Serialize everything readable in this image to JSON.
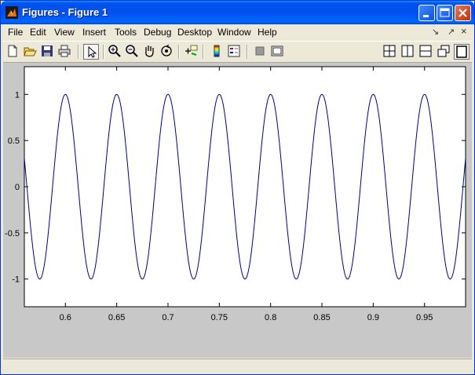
{
  "window": {
    "title": "Figures - Figure 1"
  },
  "menu": {
    "items": [
      "File",
      "Edit",
      "View",
      "Insert",
      "Tools",
      "Debug",
      "Desktop",
      "Window",
      "Help"
    ],
    "right": [
      "↘",
      "↗",
      "×"
    ]
  },
  "toolbar": {
    "icons": [
      "new-file-icon",
      "open-folder-icon",
      "save-icon",
      "print-icon",
      "pointer-icon",
      "zoom-in-icon",
      "zoom-out-icon",
      "pan-hand-icon",
      "rotate-3d-icon",
      "data-cursor-icon",
      "colorbar-icon",
      "legend-icon",
      "hide-plot-tools-icon",
      "show-plot-tools-icon",
      "tile-layout-icon",
      "left-right-layout-icon",
      "top-bottom-layout-icon",
      "float-icon",
      "maximize-icon"
    ]
  },
  "chart_data": {
    "type": "line",
    "title": "",
    "xlabel": "",
    "ylabel": "",
    "xlim": [
      0.56,
      0.99
    ],
    "ylim": [
      -1.3,
      1.3
    ],
    "xticks": [
      "0.6",
      "0.65",
      "0.7",
      "0.75",
      "0.8",
      "0.85",
      "0.9",
      "0.95"
    ],
    "xtick_values": [
      0.6,
      0.65,
      0.7,
      0.75,
      0.8,
      0.85,
      0.9,
      0.95
    ],
    "yticks": [
      "1",
      "0.5",
      "0",
      "-0.5",
      "-1"
    ],
    "ytick_values": [
      1,
      0.5,
      0,
      -0.5,
      -1
    ],
    "grid": false,
    "series": [
      {
        "function": "cos(2*pi*20*x)",
        "frequency_hz": 20,
        "amplitude": 1,
        "x_start": 0.56,
        "x_end": 0.99,
        "color": "#00007f"
      }
    ]
  }
}
